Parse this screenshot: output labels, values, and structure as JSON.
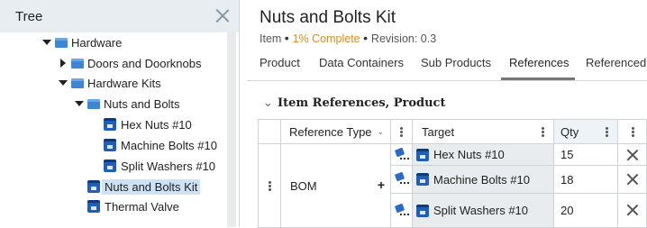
{
  "tree": {
    "title": "Tree",
    "items": [
      {
        "label": "Hardware",
        "type": "folder",
        "toggle": "expanded"
      },
      {
        "label": "Doors and Doorknobs",
        "type": "folder",
        "toggle": "collapsed"
      },
      {
        "label": "Hardware Kits",
        "type": "folder",
        "toggle": "expanded"
      },
      {
        "label": "Nuts and Bolts",
        "type": "folder",
        "toggle": "expanded"
      },
      {
        "label": "Hex Nuts #10",
        "type": "item",
        "toggle": "none"
      },
      {
        "label": "Machine Bolts #10",
        "type": "item",
        "toggle": "none"
      },
      {
        "label": "Split Washers #10",
        "type": "item",
        "toggle": "none"
      },
      {
        "label": "Nuts and Bolts Kit",
        "type": "item",
        "toggle": "none",
        "selected": true
      },
      {
        "label": "Thermal Valve",
        "type": "item",
        "toggle": "none"
      }
    ]
  },
  "item": {
    "title": "Nuts and Bolts Kit",
    "kind": "Item",
    "complete": "1% Complete",
    "revision": "Revision: 0.3"
  },
  "tabs": [
    "Product",
    "Data Containers",
    "Sub Products",
    "References",
    "Referenced"
  ],
  "active_tab": "References",
  "section": {
    "title": "Item References, Product"
  },
  "grid": {
    "headers": {
      "reference_type": "Reference Type",
      "target": "Target",
      "qty": "Qty"
    },
    "group_value": "BOM",
    "rows": [
      {
        "target": "Hex Nuts #10",
        "qty": "15"
      },
      {
        "target": "Machine Bolts #10",
        "qty": "18"
      },
      {
        "target": "Split Washers #10",
        "qty": "20"
      }
    ]
  },
  "colors": {
    "accent_orange": "#e38a1a",
    "folder_blue": "#3d86d6",
    "item_blue": "#1f5fb8",
    "selection": "#cfe2f5",
    "header_bg": "#e8edf1"
  }
}
